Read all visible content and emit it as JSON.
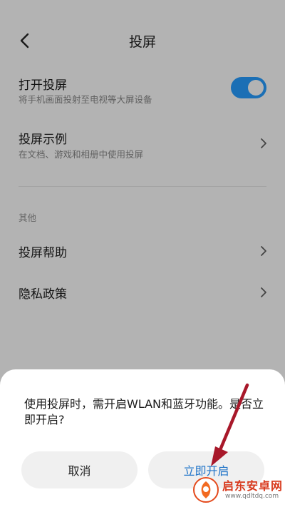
{
  "header": {
    "title": "投屏"
  },
  "settings": {
    "cast_toggle": {
      "label": "打开投屏",
      "description": "将手机画面投射至电视等大屏设备",
      "enabled": true
    },
    "cast_examples": {
      "label": "投屏示例",
      "description": "在文档、游戏和相册中使用投屏"
    }
  },
  "other_section": {
    "header": "其他",
    "items": [
      {
        "label": "投屏帮助"
      },
      {
        "label": "隐私政策"
      }
    ]
  },
  "dialog": {
    "message": "使用投屏时，需开启WLAN和蓝牙功能。是否立即开启?",
    "cancel_label": "取消",
    "confirm_label": "立即开启"
  },
  "colors": {
    "accent": "#1b6fb5",
    "confirm_text": "#1e73c8",
    "annotation_arrow": "#a8182a"
  },
  "watermark": {
    "logo_text": "启东安卓网",
    "url": "www.qdltdq.com"
  }
}
